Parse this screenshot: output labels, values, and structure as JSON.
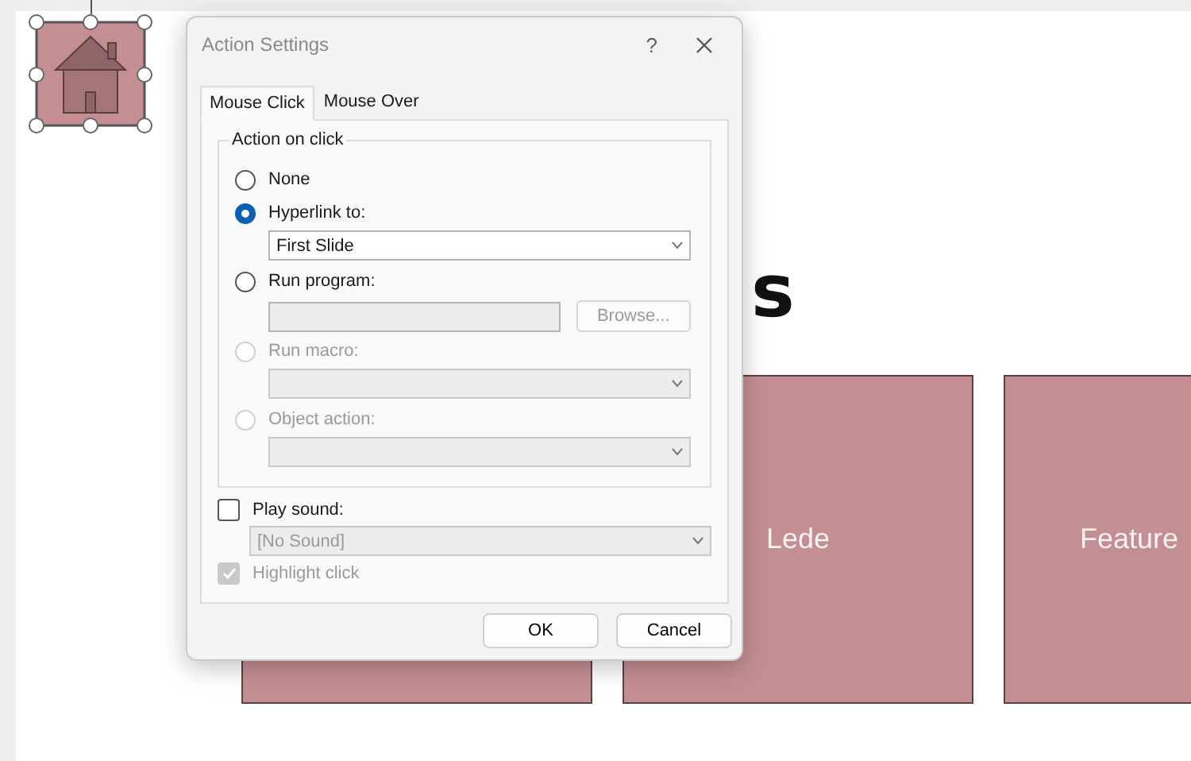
{
  "slide": {
    "title_fragment": "s",
    "house_shape": {
      "selected": true
    },
    "boxes": [
      {
        "kind": "box"
      },
      {
        "kind": "box",
        "label": "Lede"
      },
      {
        "kind": "box",
        "label": "Feature"
      }
    ]
  },
  "dialog": {
    "title": "Action Settings",
    "help": "?",
    "tabs": [
      {
        "label": "Mouse Click",
        "selected": true
      },
      {
        "label": "Mouse Over",
        "selected": false
      }
    ],
    "group": {
      "title": "Action on click",
      "rows": [
        {
          "kind": "radio",
          "label": "None",
          "selected": false,
          "disabled": false
        },
        {
          "kind": "radio",
          "label": "Hyperlink to:",
          "selected": true,
          "disabled": false
        },
        {
          "kind": "dropdown",
          "value": "First Slide",
          "disabled": false
        },
        {
          "kind": "radio",
          "label": "Run program:",
          "selected": false,
          "disabled": false
        },
        {
          "kind": "field",
          "button": "Browse...",
          "disabled": true
        },
        {
          "kind": "radio",
          "label": "Run macro:",
          "selected": false,
          "disabled": true
        },
        {
          "kind": "dropdown",
          "disabled": true
        },
        {
          "kind": "radio",
          "label": "Object action:",
          "selected": false,
          "disabled": true
        },
        {
          "kind": "dropdown",
          "disabled": true
        }
      ]
    },
    "play_sound": {
      "label": "Play sound:",
      "checked": false,
      "disabled": false
    },
    "sound": {
      "value": "[No Sound]",
      "disabled": true
    },
    "highlight": {
      "label": "Highlight click",
      "checked": true,
      "disabled": true
    },
    "buttons": [
      {
        "label": "OK"
      },
      {
        "label": "Cancel"
      }
    ]
  }
}
